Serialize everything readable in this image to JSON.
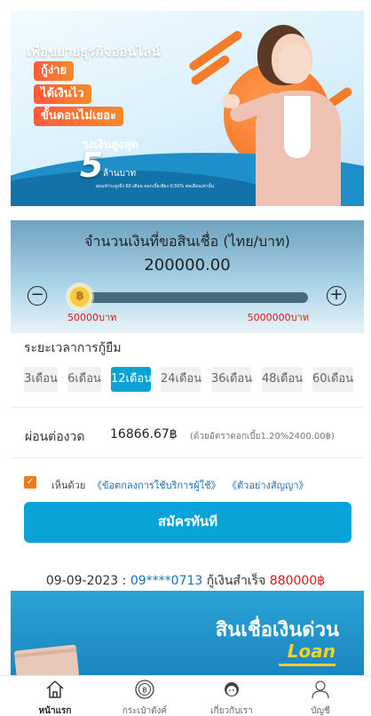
{
  "hero": {
    "tagline": "เพื่อขยายธุรกิจออนไลน์",
    "pills": [
      "กู้ง่าย",
      "ได้เงินไว",
      "ขั้นตอนไม่เยอะ"
    ],
    "limit_label": "วงเงินสูงสุด",
    "limit_number": "5",
    "limit_unit": "ล้านบาท",
    "fineprint": "ผ่อนชำระสูงถึง 60 เดือน ดอกเบี้ยเพียง 0.50% ต่อเดือนเท่านั้น"
  },
  "amount": {
    "title": "จำนวนเงินที่ขอสินเชื่อ (ไทย/บาท)",
    "value": "200000.00",
    "slider_position": 0.03,
    "min_label": "50000บาท",
    "max_label": "5000000บาท",
    "minus_symbol": "−",
    "plus_symbol": "+",
    "thumb_symbol": "฿"
  },
  "period": {
    "label": "ระยะเวลาการกู้ยืม",
    "options": [
      "3เดือน",
      "6เดือน",
      "12เดือน",
      "24เดือน",
      "36เดือน",
      "48เดือน",
      "60เดือน"
    ],
    "selected": "12เดือน"
  },
  "installment": {
    "label": "ผ่อนต่องวด",
    "value": "16866.67฿",
    "note": "(ด้วยอัตราดอกเบี้ย1.20%2400.00฿)"
  },
  "agreement": {
    "checked": true,
    "check_symbol": "✓",
    "prefix": "เห็นด้วย",
    "link_terms": "《ข้อตกลงการใช้บริการผู้ใช้》",
    "link_contract": "《ตัวอย่างสัญญา》"
  },
  "apply_button": "สมัครทันที",
  "ticker": {
    "date": "09-09-2023",
    "separator": " : ",
    "phone": "09****0713",
    "message": " กู้เงินสำเร็จ ",
    "amount": "880000฿"
  },
  "promo": {
    "title": "สินเชื่อเงินด่วน",
    "subtitle": "Loan"
  },
  "bottom_nav": {
    "items": [
      {
        "label": "หน้าแรก",
        "icon": "home-icon",
        "active": true
      },
      {
        "label": "กระเป๋าตังค์",
        "icon": "wallet-icon",
        "active": false
      },
      {
        "label": "เกี่ยวกับเรา",
        "icon": "support-icon",
        "active": false
      },
      {
        "label": "บัญชี",
        "icon": "user-icon",
        "active": false
      }
    ]
  },
  "colors": {
    "accent": "#0aa3d8",
    "checkbox": "#f07a1a",
    "range_label": "#d51a1a",
    "link": "#1a6fb3"
  }
}
